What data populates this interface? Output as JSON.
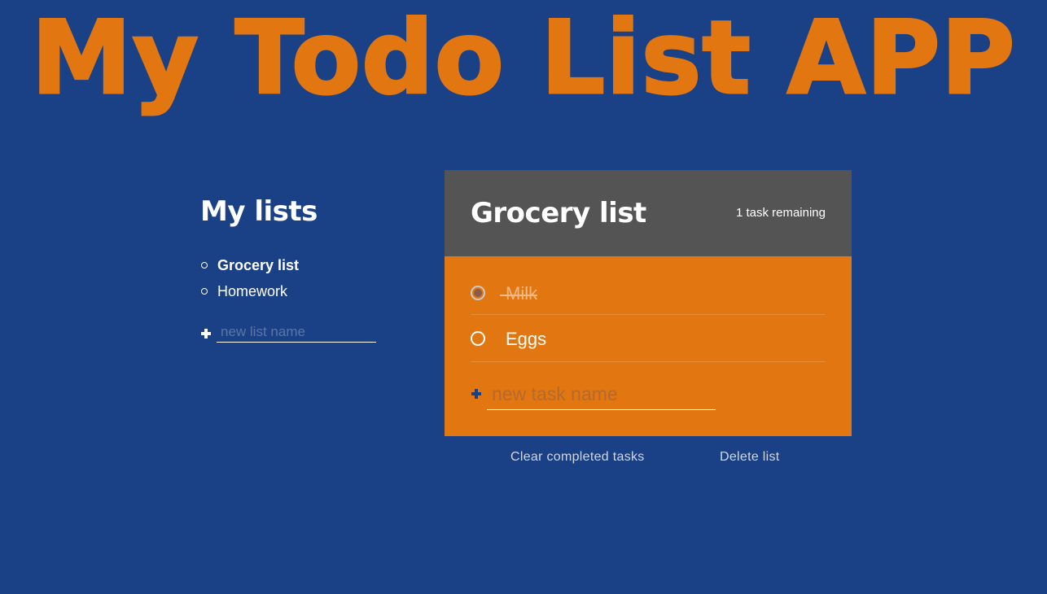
{
  "app": {
    "title": "My Todo List APP"
  },
  "lists_panel": {
    "heading": "My lists",
    "items": [
      {
        "label": "Grocery list",
        "active": true
      },
      {
        "label": "Homework",
        "active": false
      }
    ],
    "new_list_placeholder": "new list name",
    "new_list_value": ""
  },
  "todo_panel": {
    "title": "Grocery list",
    "remaining": "1 task remaining",
    "tasks": [
      {
        "label": "Milk",
        "completed": true
      },
      {
        "label": "Eggs",
        "completed": false
      }
    ],
    "new_task_placeholder": "new task name",
    "new_task_value": ""
  },
  "actions": {
    "clear_completed": "Clear completed tasks",
    "delete_list": "Delete list"
  },
  "icons": {
    "add_list": "plus-icon",
    "add_task": "plus-icon",
    "list_bullet": "circle-bullet-icon",
    "task_checkbox": "circle-checkbox-icon"
  },
  "colors": {
    "background": "#1a4085",
    "accent": "#e27712",
    "header": "#545454",
    "text": "#ffffff"
  }
}
